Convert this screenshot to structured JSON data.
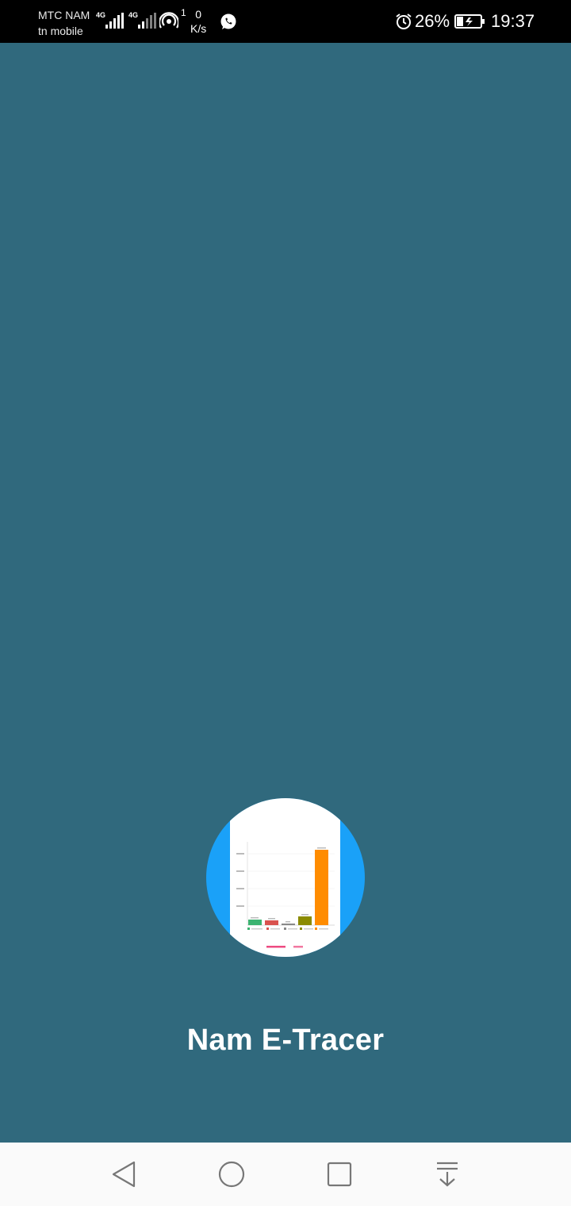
{
  "status_bar": {
    "carrier_line1": "MTC NAM",
    "carrier_line2": "tn mobile",
    "network1": "4G",
    "network2": "4G",
    "hotspot_count": "1",
    "speed_value": "0",
    "speed_unit": "K/s",
    "battery_percent": "26%",
    "time": "19:37"
  },
  "app": {
    "title": "Nam E-Tracer"
  },
  "colors": {
    "background": "#30697d",
    "logo_circle": "#1aa1f8",
    "status_bar": "#000000",
    "nav_bar": "#fafafa"
  },
  "icons": {
    "nav": [
      "back-icon",
      "home-icon",
      "recents-icon",
      "notification-pull-icon"
    ],
    "status": [
      "signal-icon",
      "hotspot-icon",
      "whatsapp-icon",
      "alarm-icon",
      "battery-charging-icon"
    ]
  }
}
